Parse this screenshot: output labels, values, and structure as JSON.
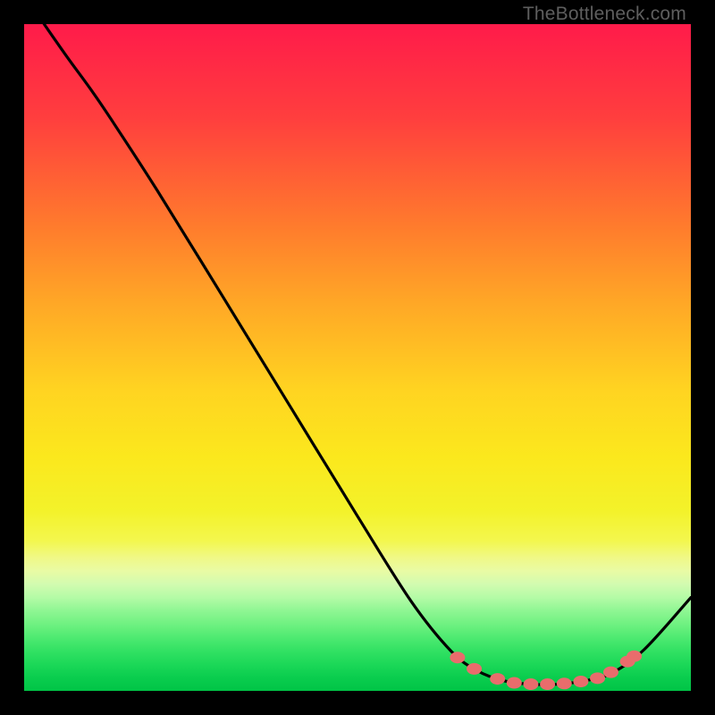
{
  "watermark": "TheBottleneck.com",
  "colors": {
    "curve_stroke": "#000000",
    "marker_fill": "#e96c6c",
    "background": "#000000"
  },
  "chart_data": {
    "type": "line",
    "title": "",
    "xlabel": "",
    "ylabel": "",
    "xlim": [
      0,
      100
    ],
    "ylim": [
      0,
      100
    ],
    "curve": {
      "name": "bottleneck-curve",
      "points": [
        {
          "x": 3.0,
          "y": 100.0
        },
        {
          "x": 6.5,
          "y": 95.0
        },
        {
          "x": 10.0,
          "y": 90.2
        },
        {
          "x": 13.0,
          "y": 85.8
        },
        {
          "x": 20.0,
          "y": 75.0
        },
        {
          "x": 30.0,
          "y": 58.8
        },
        {
          "x": 40.0,
          "y": 42.5
        },
        {
          "x": 50.0,
          "y": 26.2
        },
        {
          "x": 58.0,
          "y": 13.5
        },
        {
          "x": 64.0,
          "y": 6.0
        },
        {
          "x": 68.0,
          "y": 3.0
        },
        {
          "x": 72.0,
          "y": 1.5
        },
        {
          "x": 76.0,
          "y": 1.0
        },
        {
          "x": 80.0,
          "y": 1.0
        },
        {
          "x": 84.0,
          "y": 1.5
        },
        {
          "x": 88.0,
          "y": 2.6
        },
        {
          "x": 93.0,
          "y": 6.2
        },
        {
          "x": 100.0,
          "y": 14.0
        }
      ]
    },
    "markers": {
      "name": "highlighted-points",
      "points": [
        {
          "x": 65.0,
          "y": 5.0
        },
        {
          "x": 67.5,
          "y": 3.3
        },
        {
          "x": 71.0,
          "y": 1.8
        },
        {
          "x": 73.5,
          "y": 1.2
        },
        {
          "x": 76.0,
          "y": 1.0
        },
        {
          "x": 78.5,
          "y": 1.0
        },
        {
          "x": 81.0,
          "y": 1.1
        },
        {
          "x": 83.5,
          "y": 1.4
        },
        {
          "x": 86.0,
          "y": 1.9
        },
        {
          "x": 88.0,
          "y": 2.8
        },
        {
          "x": 90.5,
          "y": 4.4
        },
        {
          "x": 91.5,
          "y": 5.2
        }
      ]
    }
  }
}
